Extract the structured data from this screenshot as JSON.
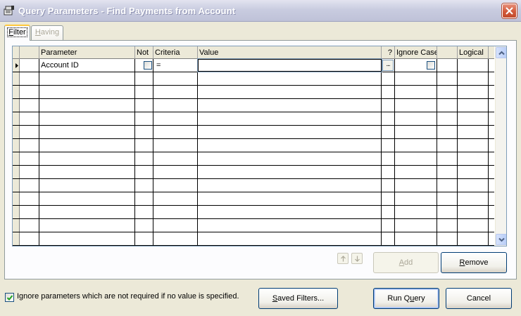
{
  "window": {
    "title": "Query Parameters - Find Payments from Account",
    "app_icon": "query-parameters-icon",
    "close_icon": "close-icon"
  },
  "tabs": [
    {
      "label": "Filter",
      "active": true
    },
    {
      "label": "Having",
      "active": false
    }
  ],
  "grid": {
    "columns": [
      "Parameter",
      "Not",
      "Criteria",
      "Value",
      "?",
      "Ignore Case",
      "Logical"
    ],
    "rows": [
      {
        "parameter": "Account ID",
        "not": false,
        "criteria": "=",
        "value": "",
        "ellipsis": "...",
        "ignore_case": false,
        "logical": ""
      }
    ],
    "empty_row_count": 13,
    "current_row_indicator": "triangle-right-icon",
    "scroll_up_icon": "scroll-up-icon",
    "scroll_down_icon": "scroll-down-icon"
  },
  "order_buttons": {
    "up_icon": "arrow-up-icon",
    "down_icon": "arrow-down-icon"
  },
  "buttons": {
    "add": "Add",
    "remove": "Remove",
    "saved_filters": "Saved Filters...",
    "run_query": "Run Query",
    "cancel": "Cancel"
  },
  "footer": {
    "ignore_checkbox_checked": true,
    "ignore_label": "Ignore parameters which are not required if no value is specified."
  }
}
